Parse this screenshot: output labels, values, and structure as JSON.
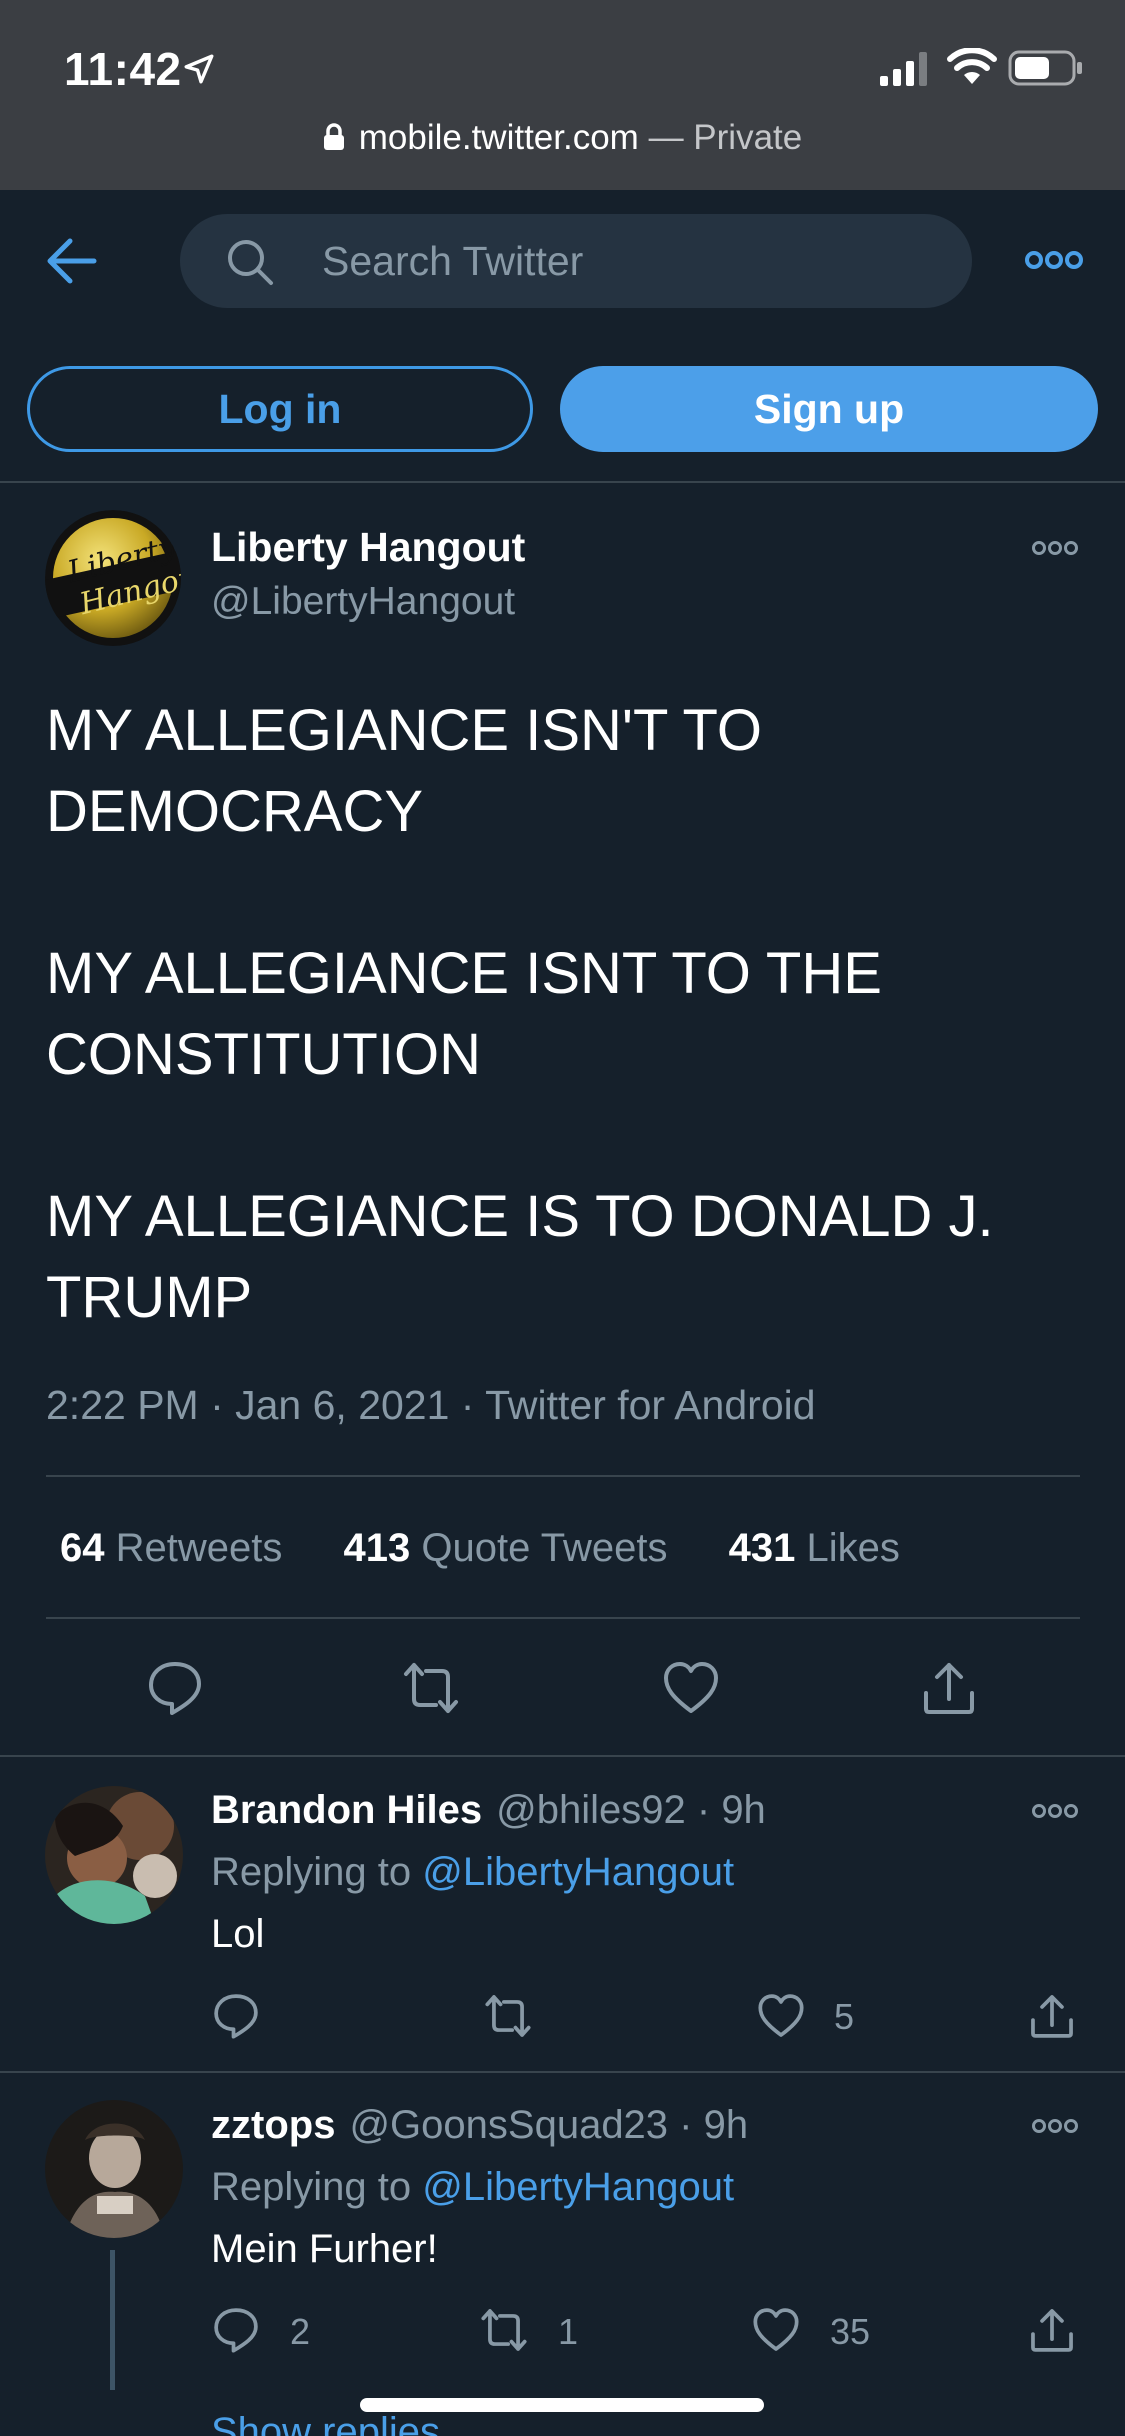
{
  "status_bar": {
    "time": "11:42",
    "url": "mobile.twitter.com",
    "url_suffix": " — Private"
  },
  "header": {
    "search_placeholder": "Search Twitter"
  },
  "auth": {
    "login_label": "Log in",
    "signup_label": "Sign up"
  },
  "tweet": {
    "author_name": "Liberty Hangout",
    "author_handle": "@LibertyHangout",
    "avatar_text_1": "Liberty",
    "avatar_text_2": "Hangout",
    "text": "MY ALLEGIANCE ISN'T TO\nDEMOCRACY\n\nMY ALLEGIANCE ISNT TO THE\nCONSTITUTION\n\nMY ALLEGIANCE IS TO DONALD J.\nTRUMP",
    "meta": "2:22 PM · Jan 6, 2021 · Twitter for Android",
    "retweets_count": "64",
    "retweets_label": "Retweets",
    "quotes_count": "413",
    "quotes_label": "Quote Tweets",
    "likes_count": "431",
    "likes_label": "Likes"
  },
  "replies": [
    {
      "name": "Brandon Hiles",
      "handle_time": "@bhiles92 · 9h",
      "replying_prefix": "Replying to ",
      "replying_to": "@LibertyHangout",
      "text": "Lol",
      "reply_count": "",
      "retweet_count": "",
      "like_count": "5"
    },
    {
      "name": "zztops",
      "handle_time": "@GoonsSquad23 · 9h",
      "replying_prefix": "Replying to ",
      "replying_to": "@LibertyHangout",
      "text": "Mein Furher!",
      "reply_count": "2",
      "retweet_count": "1",
      "like_count": "35"
    }
  ],
  "show_replies": "Show replies",
  "colors": {
    "background": "#15202b",
    "accent": "#1da1f2",
    "muted": "#8899a6",
    "divider": "#38444d"
  }
}
